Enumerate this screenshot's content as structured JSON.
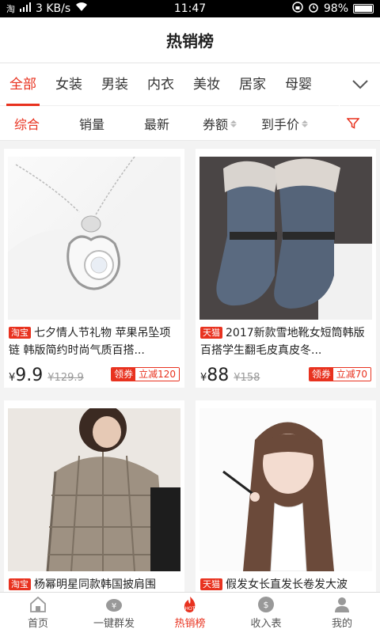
{
  "status_bar": {
    "left": "3 KB/s",
    "time": "11:47",
    "battery": "98%"
  },
  "header": {
    "title": "热销榜"
  },
  "categories": {
    "items": [
      "全部",
      "女装",
      "男装",
      "内衣",
      "美妆",
      "居家",
      "母婴"
    ],
    "active_index": 0
  },
  "sort": {
    "items": [
      {
        "label": "综合",
        "active": true
      },
      {
        "label": "销量"
      },
      {
        "label": "最新"
      },
      {
        "label": "券额"
      },
      {
        "label": "到手价"
      }
    ]
  },
  "products": [
    {
      "shop": "淘宝",
      "title": "七夕情人节礼物 苹果吊坠项链 韩版简约时尚气质百搭...",
      "currency": "¥",
      "price": "9.9",
      "old_price": "¥129.9",
      "coupon_label": "领券",
      "coupon_value": "立减120"
    },
    {
      "shop": "天猫",
      "title": "2017新款雪地靴女短筒韩版百搭学生翻毛皮真皮冬...",
      "currency": "¥",
      "price": "88",
      "old_price": "¥158",
      "coupon_label": "领券",
      "coupon_value": "立减70"
    },
    {
      "shop": "淘宝",
      "title": "杨幂明星同款韩国披肩围"
    },
    {
      "shop": "天猫",
      "title": "假发女长直发长卷发大波"
    }
  ],
  "tabs": [
    {
      "label": "首页",
      "icon": "home-icon"
    },
    {
      "label": "一键群发",
      "icon": "share-money-icon"
    },
    {
      "label": "热销榜",
      "icon": "hot-icon",
      "badge": "HOT",
      "active": true
    },
    {
      "label": "收入表",
      "icon": "income-icon"
    },
    {
      "label": "我的",
      "icon": "user-icon"
    }
  ],
  "colors": {
    "accent": "#e8321f",
    "background": "#f3f3f3"
  }
}
